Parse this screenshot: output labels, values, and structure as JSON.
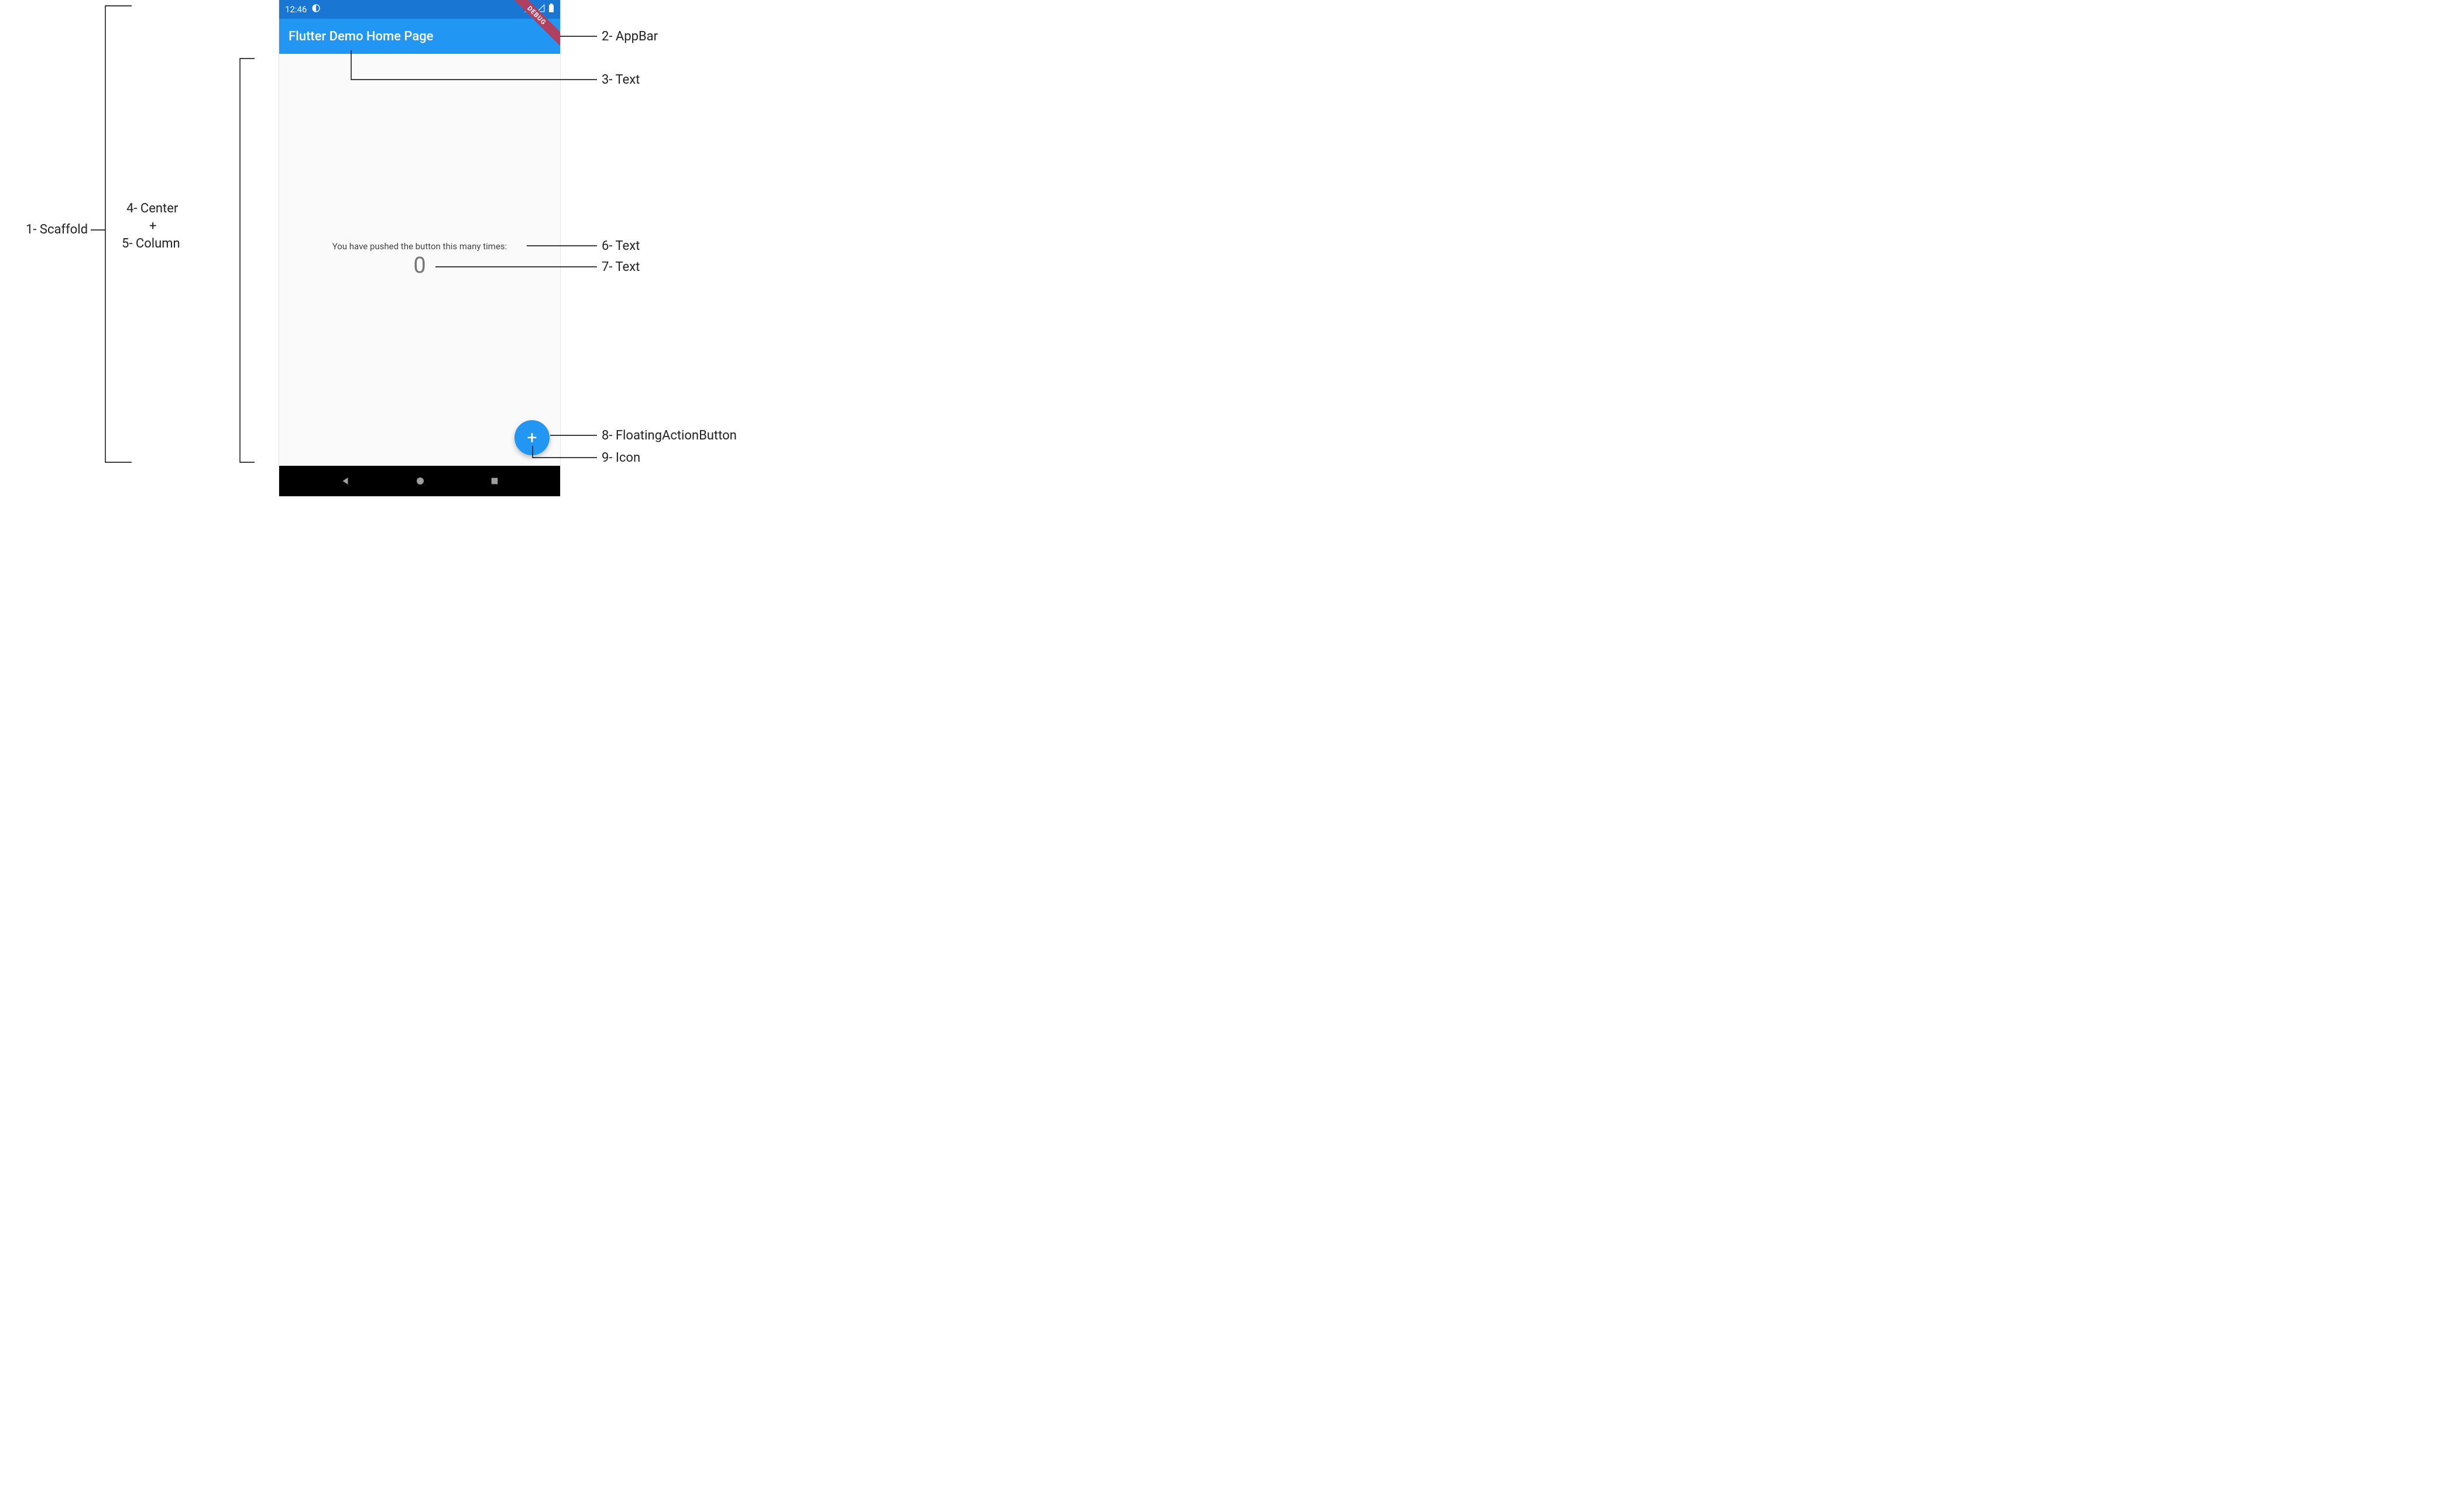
{
  "phone": {
    "status_bar": {
      "time": "12:46",
      "debug_ribbon": "DEBUG"
    },
    "app_bar": {
      "title": "Flutter Demo Home Page"
    },
    "body": {
      "text1": "You have pushed the button this many times:",
      "text2": "0"
    },
    "fab": {
      "icon_label": "+"
    }
  },
  "callouts": {
    "left": {
      "scaffold": "1- Scaffold",
      "center": "4- Center",
      "plus": "+",
      "column": "5- Column"
    },
    "right": {
      "app_bar": "2- AppBar",
      "text_title": "3- Text",
      "text_body1": "6- Text",
      "text_body2": "7- Text",
      "fab": "8- FloatingActionButton",
      "fab_icon": "9- Icon"
    }
  }
}
